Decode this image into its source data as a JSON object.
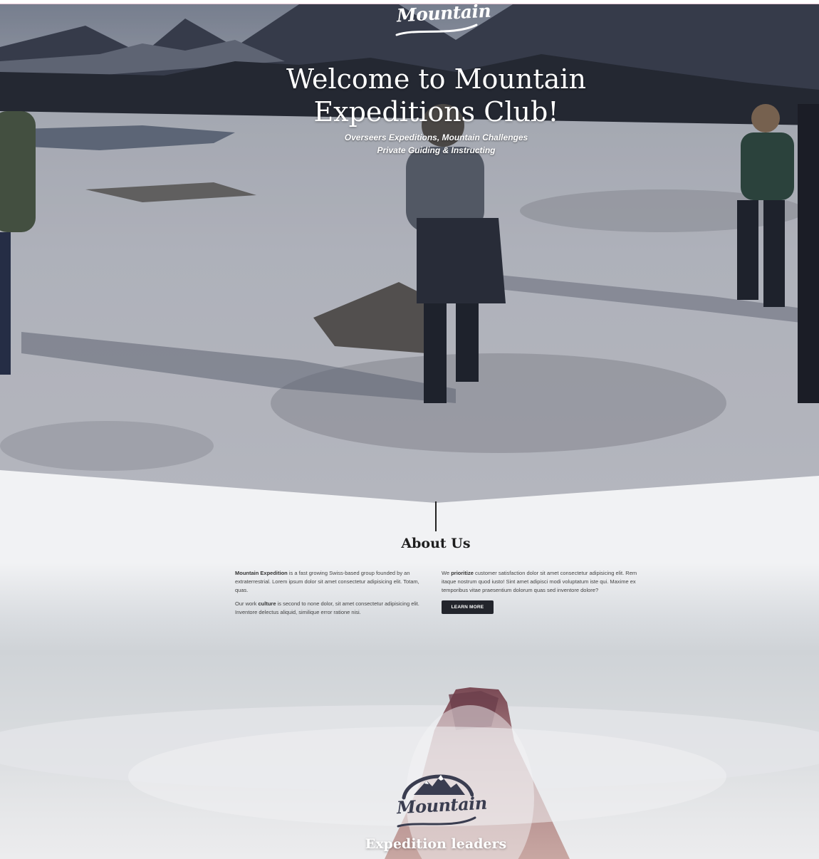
{
  "brand": {
    "name": "Mountain"
  },
  "hero": {
    "title": "Welcome to Mountain Expeditions Club!",
    "subtitle_line1": "Overseers Expeditions, Mountain Challenges",
    "subtitle_line2": "Private Guiding & Instructing"
  },
  "about": {
    "title": "About Us",
    "left_p1_bold": "Mountain Expedition",
    "left_p1_text": " is a fast growing Swiss-based group founded by an extraterrestrial. Lorem ipsum dolor sit amet consectetur adipisicing elit. Totam, quas.",
    "left_p2_pre": "Our work ",
    "left_p2_bold": "culture",
    "left_p2_text": " is second to none dolor, sit amet consectetur adipisicing elit. Inventore delectus aliquid, similique error ratione nisi.",
    "right_p1_pre": "We ",
    "right_p1_bold": "prioritize",
    "right_p1_text": " customer satisfaction dolor sit amet consectetur adipisicing elit. Rem itaque nostrum quod iusto! Sint amet adipisci modi voluptatum iste qui. Maxime ex temporibus vitae praesentium dolorum quas sed inventore dolore?",
    "button_label": "LEARN MORE"
  },
  "leaders": {
    "title": "Expedition leaders"
  },
  "colors": {
    "accent_dark": "#23252c",
    "logo_dark": "#3a3d50",
    "page_bg": "#f1f2f4"
  }
}
